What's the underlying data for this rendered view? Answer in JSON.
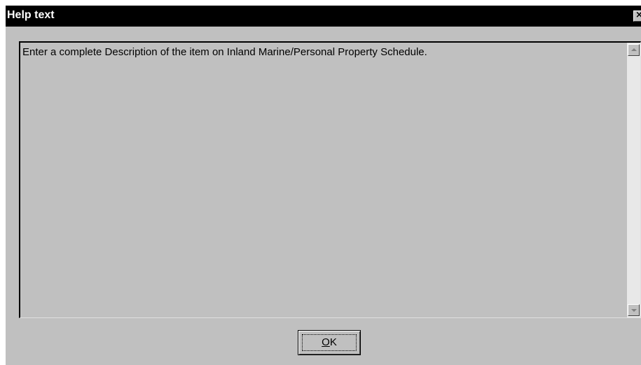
{
  "window": {
    "title": "Help text",
    "close_glyph": "×"
  },
  "help": {
    "text": "Enter a complete Description of the item on Inland Marine/Personal Property Schedule."
  },
  "buttons": {
    "ok_mnemonic": "O",
    "ok_rest": "K"
  },
  "icons": {
    "close": "close-icon",
    "scroll_up": "scroll-up-arrow-icon",
    "scroll_down": "scroll-down-arrow-icon"
  },
  "colors": {
    "titlebar": "#000000",
    "title_text": "#ffffff",
    "window_face": "#c0c0c0"
  }
}
